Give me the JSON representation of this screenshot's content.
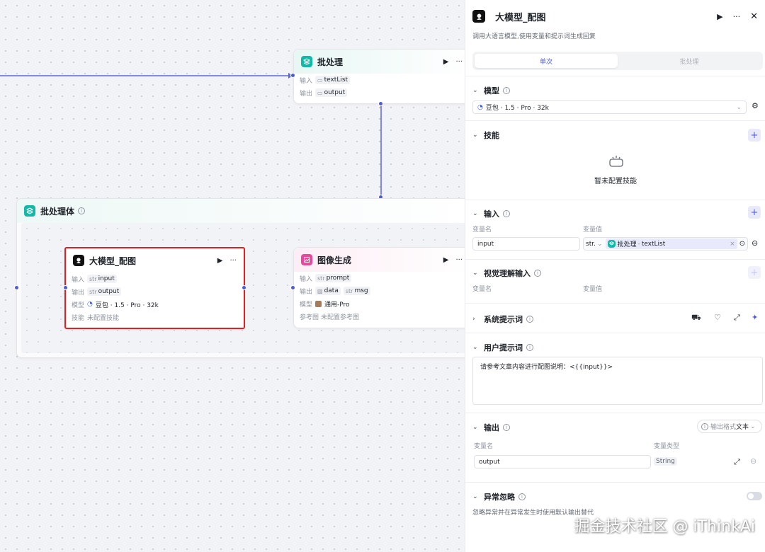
{
  "canvas": {
    "batch_node": {
      "title": "批处理",
      "rows": [
        {
          "key": "输入",
          "value": "textList"
        },
        {
          "key": "输出",
          "value": "output"
        }
      ]
    },
    "batch_body": {
      "title": "批处理体"
    },
    "llm_node": {
      "title": "大模型_配图",
      "input_key": "输入",
      "input_type": "str",
      "input_value": "input",
      "output_key": "输出",
      "output_type": "str",
      "output_value": "output",
      "model_key": "模型",
      "model_value": "豆包 · 1.5 · Pro · 32k",
      "skill_key": "技能",
      "skill_value": "未配置技能"
    },
    "image_node": {
      "title": "图像生成",
      "input_key": "输入",
      "input_type": "str",
      "input_value": "prompt",
      "output_key": "输出",
      "output_value_1": "data",
      "output_type_2": "str",
      "output_value_2": "msg",
      "model_key": "模型",
      "model_value": "通用-Pro",
      "ref_key": "参考图",
      "ref_value": "未配置参考图"
    }
  },
  "panel": {
    "title": "大模型_配图",
    "description": "调用大语言模型,使用变量和提示词生成回复",
    "tabs": [
      {
        "label": "单次",
        "active": true
      },
      {
        "label": "批处理",
        "active": false
      }
    ],
    "model": {
      "title": "模型",
      "value": "豆包 · 1.5 · Pro · 32k"
    },
    "skills": {
      "title": "技能",
      "empty": "暂未配置技能"
    },
    "input": {
      "title": "输入",
      "col_name": "变量名",
      "col_value": "变量值",
      "row": {
        "name": "input",
        "type": "str.",
        "ref_node": "批处理",
        "ref_sep": "-",
        "ref_var": "textList"
      }
    },
    "vision": {
      "title": "视觉理解输入",
      "col_name": "变量名",
      "col_value": "变量值"
    },
    "system_prompt": {
      "title": "系统提示词"
    },
    "user_prompt": {
      "title": "用户提示词",
      "content": "请参考文章内容进行配图说明：<{{input}}>"
    },
    "output": {
      "title": "输出",
      "format_label": "输出格式",
      "format_value": "文本",
      "col_name": "变量名",
      "col_type": "变量类型",
      "row": {
        "name": "output",
        "type": "String"
      }
    },
    "exception": {
      "title": "异常忽略",
      "description": "忽略异常并在异常发生时使用默认输出替代"
    }
  },
  "watermark": "掘金技术社区 @ iThinkAi",
  "colors": {
    "accent": "#4e5bd7",
    "highlight_border": "#e02020"
  }
}
